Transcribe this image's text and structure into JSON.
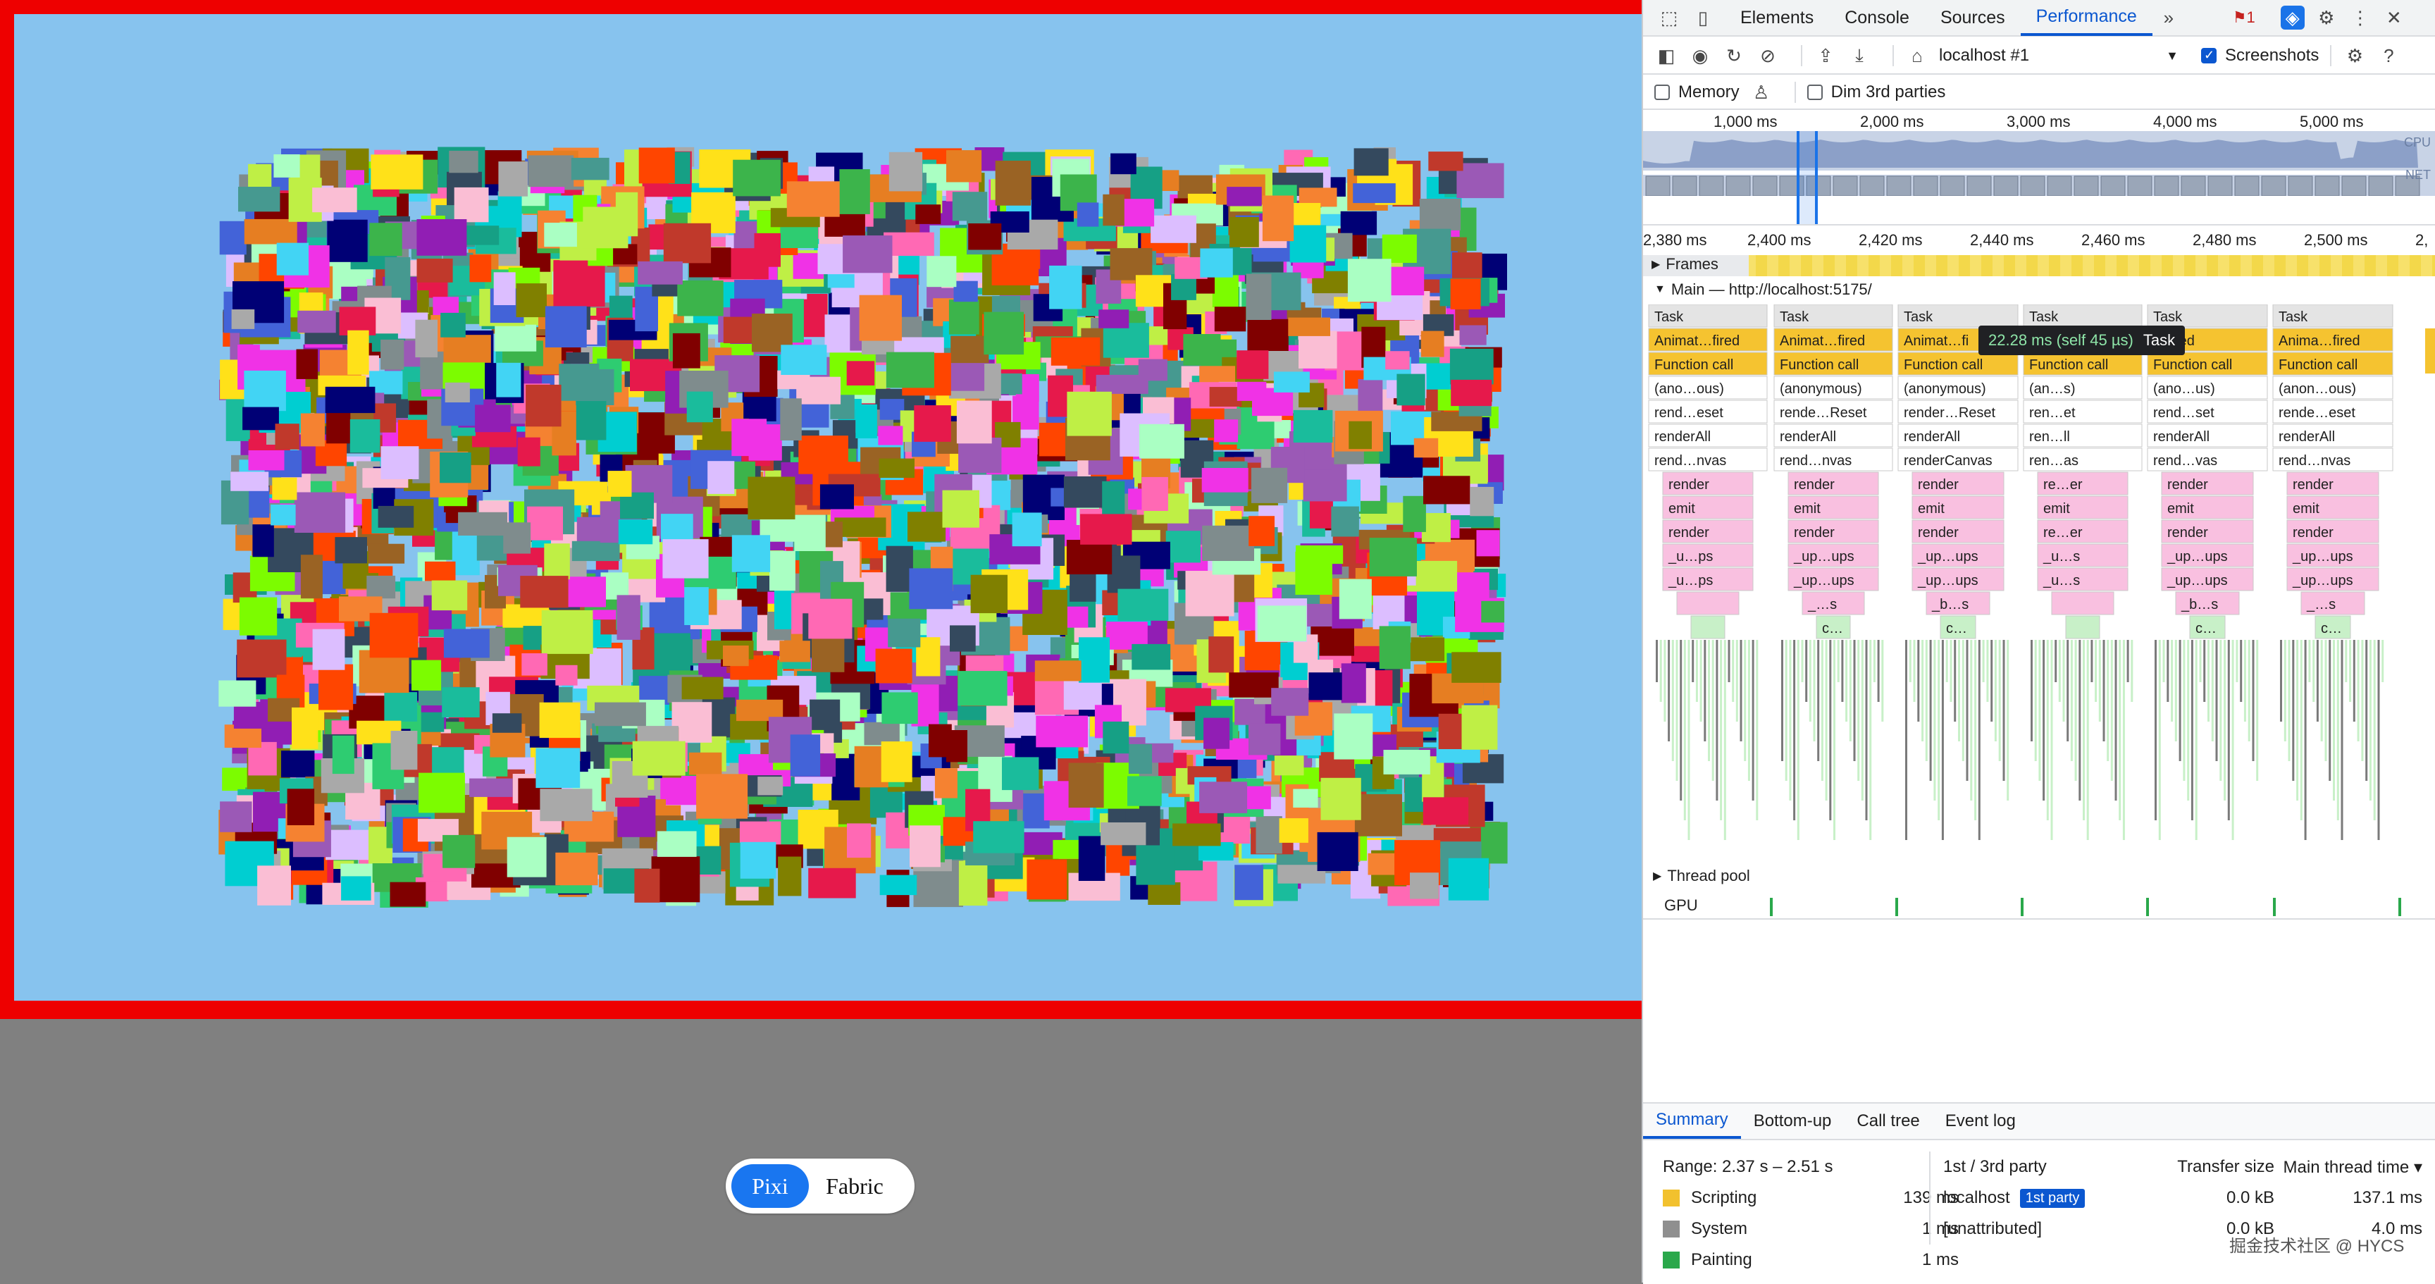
{
  "page": {
    "stage_border_color": "#ee0000",
    "stage_background": "#87c3ee",
    "switcher": {
      "pixi_label": "Pixi",
      "fabric_label": "Fabric",
      "active": "Pixi"
    }
  },
  "devtools": {
    "tabs": [
      "Elements",
      "Console",
      "Sources",
      "Performance"
    ],
    "active_tab": "Performance",
    "issues_badge": "1",
    "toolbar": {
      "target": "localhost #1",
      "screenshots_label": "Screenshots",
      "screenshots_checked": true,
      "memory_label": "Memory",
      "memory_checked": false,
      "dim_label": "Dim 3rd parties",
      "dim_checked": false
    },
    "overview_ruler": [
      "1,000 ms",
      "2,000 ms",
      "3,000 ms",
      "4,000 ms",
      "5,000 ms"
    ],
    "overview_tracks": [
      "CPU",
      "NET"
    ],
    "detail_ruler": [
      "2,380 ms",
      "2,400 ms",
      "2,420 ms",
      "2,440 ms",
      "2,460 ms",
      "2,480 ms",
      "2,500 ms",
      "2,"
    ],
    "frames_label": "Frames",
    "main_label": "Main — http://localhost:5175/",
    "flame_columns": [
      [
        "Task",
        "Animat…fired",
        "Function call",
        "(ano…ous)",
        "rend…eset",
        "renderAll",
        "rend…nvas",
        "render",
        "emit",
        "render",
        "_u…ps",
        "_u…ps",
        "",
        ""
      ],
      [
        "Task",
        "Animat…fired",
        "Function call",
        "(anonymous)",
        "rende…Reset",
        "renderAll",
        "rend…nvas",
        "render",
        "emit",
        "render",
        "_up…ups",
        "_up…ups",
        "_…s",
        "c…"
      ],
      [
        "Task",
        "Animat…fi",
        "Function call",
        "(anonymous)",
        "render…Reset",
        "renderAll",
        "renderCanvas",
        "render",
        "emit",
        "render",
        "_up…ups",
        "_up…ups",
        "_b…s",
        "c…"
      ],
      [
        "Task",
        "",
        "Function call",
        "(an…s)",
        "ren…et",
        "ren…ll",
        "ren…as",
        "re…er",
        "emit",
        "re…er",
        "_u…s",
        "_u…s",
        "",
        ""
      ],
      [
        "Task",
        "…fired",
        "Function call",
        "(ano…us)",
        "rend…set",
        "renderAll",
        "rend…vas",
        "render",
        "emit",
        "render",
        "_up…ups",
        "_up…ups",
        "_b…s",
        "c…"
      ],
      [
        "Task",
        "Anima…fired",
        "Function call",
        "(anon…ous)",
        "rende…eset",
        "renderAll",
        "rend…nvas",
        "render",
        "emit",
        "render",
        "_up…ups",
        "_up…ups",
        "_…s",
        "c…"
      ]
    ],
    "tooltip": {
      "time": "22.28 ms (self 45 µs)",
      "name": "Task"
    },
    "lower_tracks": {
      "thread_pool": "Thread pool",
      "gpu": "GPU"
    },
    "bottom_tabs": [
      "Summary",
      "Bottom-up",
      "Call tree",
      "Event log"
    ],
    "summary": {
      "range": "Range: 2.37 s – 2.51 s",
      "items": [
        {
          "label": "Scripting",
          "value": "139 ms",
          "color": "#f2c12e"
        },
        {
          "label": "System",
          "value": "1 ms",
          "color": "#8f8f8f"
        },
        {
          "label": "Painting",
          "value": "1 ms",
          "color": "#2aa84b"
        }
      ],
      "third_party": {
        "headers": [
          "1st / 3rd party",
          "Transfer size",
          "Main thread time ▾"
        ],
        "rows": [
          {
            "name": "localhost",
            "badge": "1st party",
            "size": "0.0 kB",
            "time": "137.1 ms"
          },
          {
            "name": "[unattributed]",
            "badge": "",
            "size": "0.0 kB",
            "time": "4.0 ms"
          }
        ]
      }
    }
  },
  "watermark": "掘金技术社区 @ HYCS"
}
